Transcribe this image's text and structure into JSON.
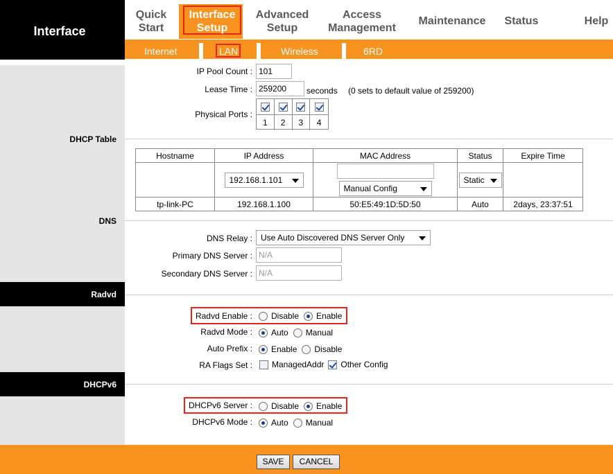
{
  "header": {
    "title": "Interface",
    "nav": [
      {
        "line1": "Quick",
        "line2": "Start"
      },
      {
        "line1": "Interface",
        "line2": "Setup"
      },
      {
        "line1": "Advanced",
        "line2": "Setup"
      },
      {
        "line1": "Access",
        "line2": "Management"
      },
      {
        "line1": "Maintenance",
        "line2": ""
      },
      {
        "line1": "Status",
        "line2": ""
      },
      {
        "line1": "Help",
        "line2": ""
      }
    ],
    "subnav": [
      "Internet",
      "LAN",
      "Wireless",
      "6RD"
    ]
  },
  "dhcp": {
    "section_label": "DHCP Table",
    "ip_pool_label": "IP Pool Count :",
    "ip_pool_value": "101",
    "lease_label": "Lease Time :",
    "lease_value": "259200",
    "lease_unit": "seconds",
    "lease_hint": "(0 sets to default value of 259200)",
    "ports_label": "Physical Ports :",
    "ports": [
      "1",
      "2",
      "3",
      "4"
    ],
    "table": {
      "headers": [
        "Hostname",
        "IP Address",
        "MAC Address",
        "Status",
        "Expire Time"
      ],
      "edit_row": {
        "ip": "192.168.1.101",
        "mac_mode": "Manual Config",
        "status": "Static"
      },
      "rows": [
        {
          "hostname": "tp-link-PC",
          "ip": "192.168.1.100",
          "mac": "50:E5:49:1D:5D:50",
          "status": "Auto",
          "expire": "2days, 23:37:51"
        }
      ]
    }
  },
  "dns": {
    "section_label": "DNS",
    "relay_label": "DNS Relay :",
    "relay_value": "Use Auto Discovered DNS Server Only",
    "primary_label": "Primary DNS Server :",
    "primary_value": "N/A",
    "secondary_label": "Secondary DNS Server :",
    "secondary_value": "N/A"
  },
  "radvd": {
    "section_label": "Radvd",
    "enable_label": "Radvd Enable :",
    "disable_opt": "Disable",
    "enable_opt": "Enable",
    "mode_label": "Radvd Mode :",
    "mode_auto": "Auto",
    "mode_manual": "Manual",
    "prefix_label": "Auto Prefix :",
    "prefix_enable": "Enable",
    "prefix_disable": "Disable",
    "flags_label": "RA Flags Set :",
    "flag_managed": "ManagedAddr",
    "flag_other": "Other Config"
  },
  "dhcpv6": {
    "section_label": "DHCPv6",
    "server_label": "DHCPv6 Server :",
    "disable_opt": "Disable",
    "enable_opt": "Enable",
    "mode_label": "DHCPv6 Mode :",
    "mode_auto": "Auto",
    "mode_manual": "Manual"
  },
  "footer": {
    "save": "SAVE",
    "cancel": "CANCEL"
  },
  "colors": {
    "accent_orange": "#f7931e",
    "highlight_red": "#e52620",
    "header_black": "#000000",
    "sidebar_gray": "#e5e5e5"
  }
}
